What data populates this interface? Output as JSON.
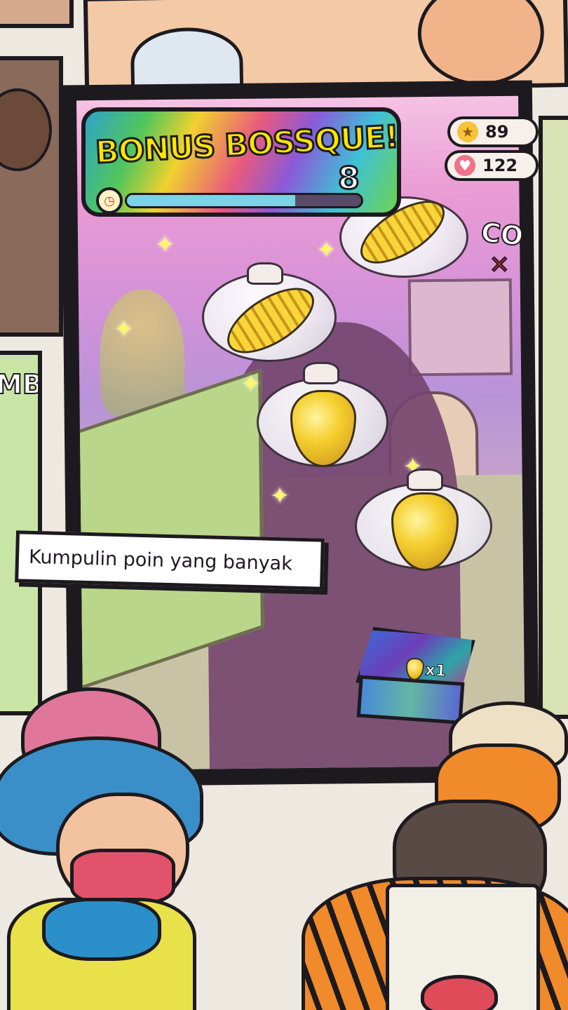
{
  "bonus": {
    "title": "BONUS BOSSQUE!",
    "count": "8",
    "timer_progress": 0.72
  },
  "stats": {
    "stars": "89",
    "hearts": "122"
  },
  "combo": {
    "label": "CO",
    "mark": "✕"
  },
  "caption": "Kumpulin poin yang banyak",
  "basket": {
    "item_count": "x1"
  },
  "icons": {
    "timer": "stopwatch-icon",
    "star": "star-icon",
    "heart": "heart-icon"
  },
  "colors": {
    "accent_yellow": "#ffe600",
    "outline": "#1d1a1f",
    "timer_fill": "#7ad3e6"
  }
}
